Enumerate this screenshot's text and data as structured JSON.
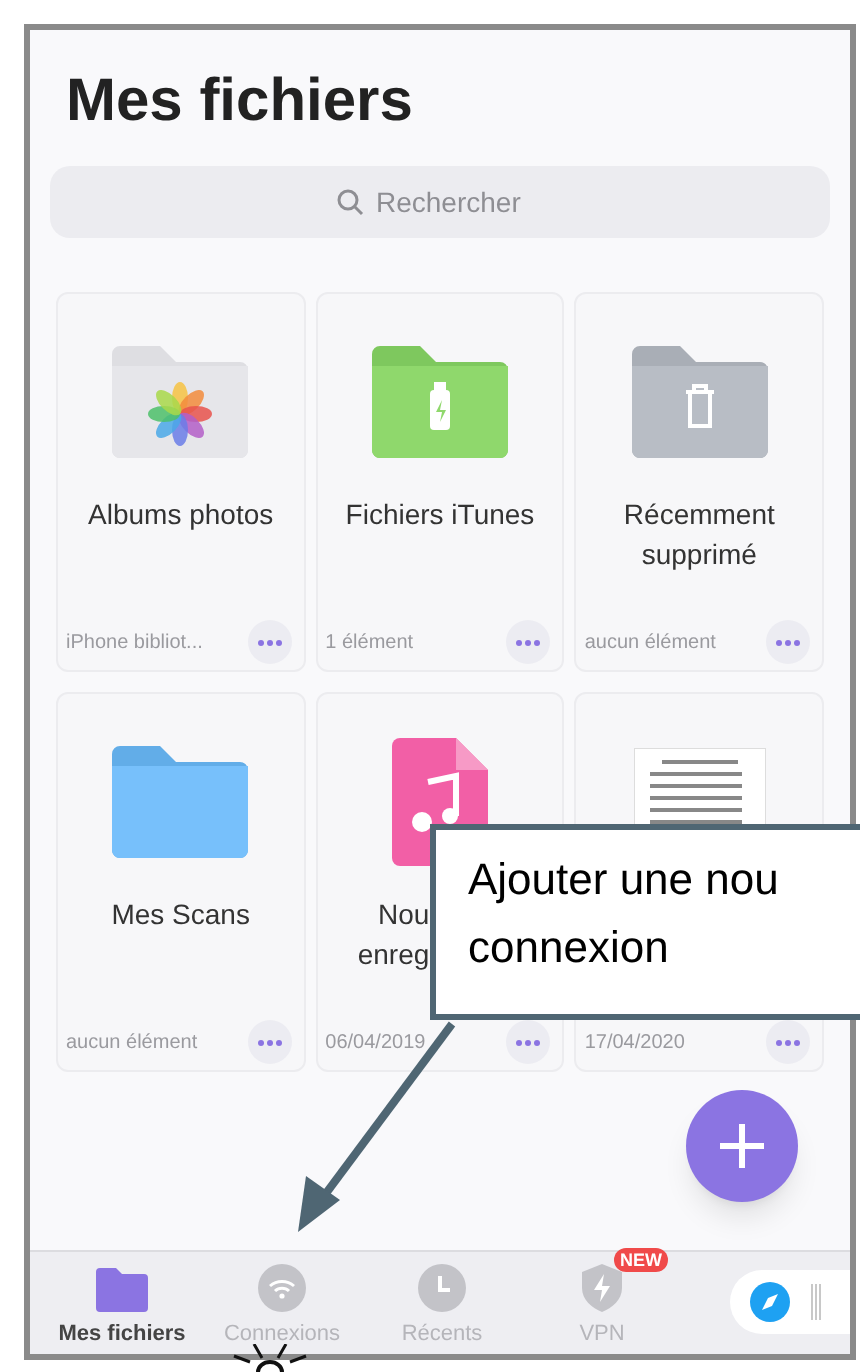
{
  "title": "Mes fichiers",
  "search": {
    "placeholder": "Rechercher"
  },
  "items": [
    {
      "kind": "photos",
      "title": "Albums photos",
      "meta": "iPhone bibliot...",
      "covered": false
    },
    {
      "kind": "itunes",
      "title": "Fichiers iTunes",
      "meta": "1 élément",
      "covered": false
    },
    {
      "kind": "trash",
      "title": "Récemment supprimé",
      "meta": "aucun élément",
      "covered": false
    },
    {
      "kind": "scans",
      "title": "Mes Scans",
      "meta": "aucun élément",
      "covered": false
    },
    {
      "kind": "audio",
      "title": "Nou enreg",
      "meta": "06/04/2019",
      "covered": true
    },
    {
      "kind": "document",
      "meta": "17/04/2020"
    }
  ],
  "tabs": [
    {
      "kind": "files",
      "label": "Mes fichiers",
      "selected": true
    },
    {
      "kind": "connections",
      "label": "Connexions",
      "selected": false
    },
    {
      "kind": "recent",
      "label": "Récents",
      "selected": false
    },
    {
      "kind": "vpn",
      "label": "VPN",
      "selected": false,
      "badge": "NEW"
    }
  ],
  "callout": {
    "text": "Ajouter une nou connexion"
  }
}
